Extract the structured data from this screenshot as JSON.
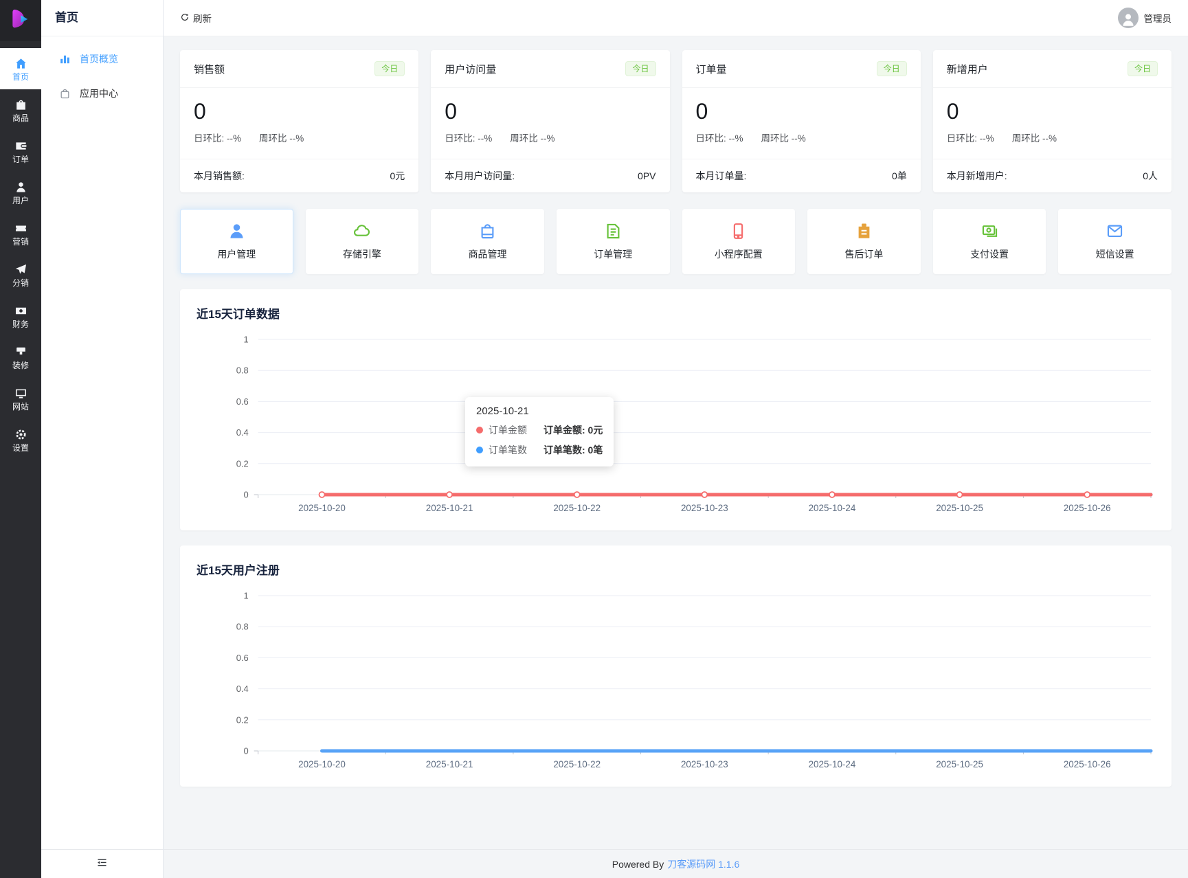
{
  "topbar": {
    "refresh_label": "刷新",
    "username": "管理员"
  },
  "rail": {
    "items": [
      {
        "label": "首页",
        "icon": "home-icon",
        "active": true
      },
      {
        "label": "商品",
        "icon": "goods-icon",
        "active": false
      },
      {
        "label": "订单",
        "icon": "orders-icon",
        "active": false
      },
      {
        "label": "用户",
        "icon": "users-icon",
        "active": false
      },
      {
        "label": "营销",
        "icon": "marketing-icon",
        "active": false
      },
      {
        "label": "分销",
        "icon": "distribution-icon",
        "active": false
      },
      {
        "label": "财务",
        "icon": "finance-icon",
        "active": false
      },
      {
        "label": "装修",
        "icon": "decorate-icon",
        "active": false
      },
      {
        "label": "网站",
        "icon": "website-icon",
        "active": false
      },
      {
        "label": "设置",
        "icon": "settings-icon",
        "active": false
      }
    ]
  },
  "submenu": {
    "title": "首页",
    "items": [
      {
        "label": "首页概览",
        "icon": "overview-icon",
        "active": true
      },
      {
        "label": "应用中心",
        "icon": "app-center-icon",
        "active": false
      }
    ]
  },
  "stats": [
    {
      "title": "销售额",
      "badge": "今日",
      "value": "0",
      "day_ratio": "日环比: --%",
      "week_ratio": "周环比 --%",
      "footer_label": "本月销售额:",
      "footer_value": "0元"
    },
    {
      "title": "用户访问量",
      "badge": "今日",
      "value": "0",
      "day_ratio": "日环比: --%",
      "week_ratio": "周环比 --%",
      "footer_label": "本月用户访问量:",
      "footer_value": "0PV"
    },
    {
      "title": "订单量",
      "badge": "今日",
      "value": "0",
      "day_ratio": "日环比: --%",
      "week_ratio": "周环比 --%",
      "footer_label": "本月订单量:",
      "footer_value": "0单"
    },
    {
      "title": "新增用户",
      "badge": "今日",
      "value": "0",
      "day_ratio": "日环比: --%",
      "week_ratio": "周环比 --%",
      "footer_label": "本月新增用户:",
      "footer_value": "0人"
    }
  ],
  "quick_links": [
    {
      "label": "用户管理",
      "icon": "user-manage-icon",
      "color": "#5b9df9",
      "highlight": true
    },
    {
      "label": "存储引擎",
      "icon": "storage-cloud-icon",
      "color": "#67c23a",
      "highlight": false
    },
    {
      "label": "商品管理",
      "icon": "goods-bag-icon",
      "color": "#5b9df9",
      "highlight": false
    },
    {
      "label": "订单管理",
      "icon": "order-doc-icon",
      "color": "#67c23a",
      "highlight": false
    },
    {
      "label": "小程序配置",
      "icon": "miniprogram-phone-icon",
      "color": "#f56c6c",
      "highlight": false
    },
    {
      "label": "售后订单",
      "icon": "aftersale-clipboard-icon",
      "color": "#e6a23c",
      "highlight": false
    },
    {
      "label": "支付设置",
      "icon": "payment-money-icon",
      "color": "#67c23a",
      "highlight": false
    },
    {
      "label": "短信设置",
      "icon": "sms-mail-icon",
      "color": "#5b9df9",
      "highlight": false
    }
  ],
  "charts": [
    {
      "id": "orders",
      "title": "近15天订单数据",
      "chart_data": {
        "type": "line",
        "x": [
          "2025-10-20",
          "2025-10-21",
          "2025-10-22",
          "2025-10-23",
          "2025-10-24",
          "2025-10-25",
          "2025-10-26"
        ],
        "series": [
          {
            "name": "订单笔数",
            "color": "#58a3f7",
            "values": [
              0,
              0,
              0,
              0,
              0,
              0,
              0
            ],
            "markers": false
          },
          {
            "name": "订单金额",
            "color": "#f56c6c",
            "values": [
              0,
              0,
              0,
              0,
              0,
              0,
              0
            ],
            "markers": true
          }
        ],
        "ylim": [
          0,
          1
        ],
        "yticks": [
          1,
          0.8,
          0.6,
          0.4,
          0.2,
          0
        ],
        "grid": "horizontal-only",
        "legend_position": "none"
      },
      "tooltip": {
        "title": "2025-10-21",
        "rows": [
          {
            "series": "订单金额",
            "label": "订单金额:",
            "value": "0元",
            "color": "#f56c6c"
          },
          {
            "series": "订单笔数",
            "label": "订单笔数:",
            "value": "0笔",
            "color": "#409eff"
          }
        ]
      }
    },
    {
      "id": "registrations",
      "title": "近15天用户注册",
      "chart_data": {
        "type": "line",
        "x": [
          "2025-10-20",
          "2025-10-21",
          "2025-10-22",
          "2025-10-23",
          "2025-10-24",
          "2025-10-25",
          "2025-10-26"
        ],
        "series": [
          {
            "name": "用户注册",
            "color": "#58a3f7",
            "values": [
              0,
              0,
              0,
              0,
              0,
              0,
              0
            ],
            "markers": false
          }
        ],
        "ylim": [
          0,
          1
        ],
        "yticks": [
          1,
          0.8,
          0.6,
          0.4,
          0.2,
          0
        ],
        "grid": "horizontal-only",
        "legend_position": "none"
      }
    }
  ],
  "footer": {
    "text": "Powered By",
    "link": "刀客源码网",
    "version": "1.1.6"
  },
  "colors": {
    "primary": "#409eff",
    "success": "#67c23a",
    "danger": "#f56c6c",
    "warning": "#e6a23c"
  }
}
